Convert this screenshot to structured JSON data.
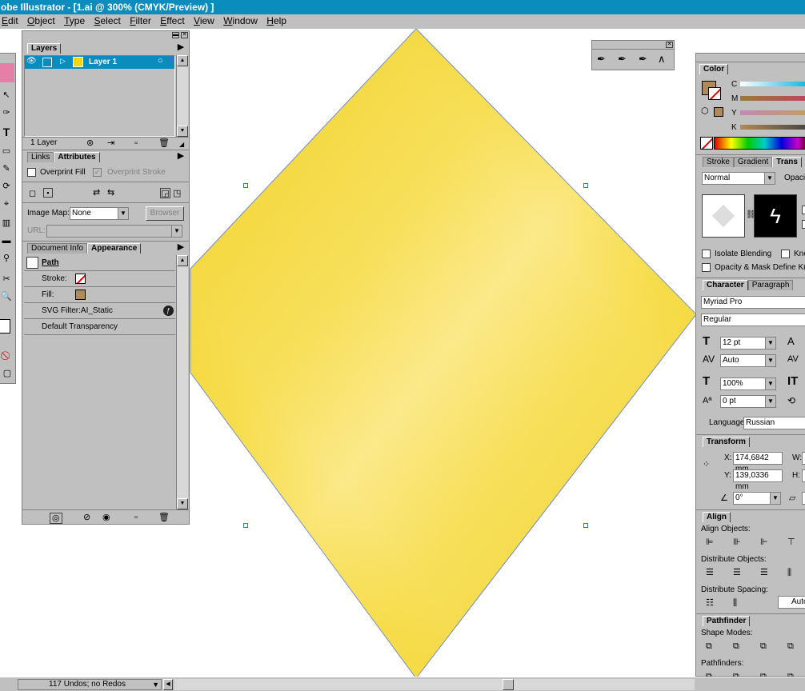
{
  "app": {
    "title": "obe Illustrator - [1.ai @ 300% (CMYK/Preview) ]"
  },
  "menu": [
    "Edit",
    "Object",
    "Type",
    "Select",
    "Filter",
    "Effect",
    "View",
    "Window",
    "Help"
  ],
  "colors": {
    "accent": "#0a8cbc",
    "diamond": "#f5d418",
    "fill_swatch": "#b08a5a"
  },
  "layers_panel": {
    "tab": "Layers",
    "layer_name": "Layer 1",
    "footer_count": "1 Layer"
  },
  "links_attr_panel": {
    "tabs": [
      "Links",
      "Attributes"
    ],
    "overprint_fill": "Overprint Fill",
    "overprint_stroke": "Overprint Stroke",
    "image_map_label": "Image Map:",
    "image_map_value": "None",
    "browser_button": "Browser",
    "url_label": "URL:"
  },
  "appearance_panel": {
    "tabs": [
      "Document Info",
      "Appearance"
    ],
    "object_name": "Path",
    "stroke_label": "Stroke:",
    "fill_label": "Fill:",
    "svg_filter": "SVG Filter:AI_Static",
    "default_transparency": "Default Transparency"
  },
  "pen_palette": {
    "icons": [
      "pen-icon",
      "add-anchor-icon",
      "delete-anchor-icon",
      "convert-anchor-icon"
    ]
  },
  "color_panel": {
    "tab": "Color",
    "channels": [
      "C",
      "M",
      "Y",
      "K"
    ]
  },
  "transparency_panel": {
    "tabs": [
      "Stroke",
      "Gradient",
      "Trans"
    ],
    "blend_mode": "Normal",
    "opacity_label": "Opaci",
    "isolate_blending": "Isolate Blending",
    "knockout": "Kno",
    "opacity_mask": "Opacity & Mask Define Kno"
  },
  "character_panel": {
    "tabs": [
      "Character",
      "Paragraph"
    ],
    "font": "Myriad Pro",
    "style": "Regular",
    "size": "12 pt",
    "tracking": "Auto",
    "scale": "100%",
    "baseline": "0 pt",
    "language_label": "Language:",
    "language": "Russian"
  },
  "transform_panel": {
    "tab": "Transform",
    "x_label": "X:",
    "x_value": "174,6842 mm",
    "y_label": "Y:",
    "y_value": "139,0336 mm",
    "w_label": "W:",
    "h_label": "H:",
    "angle": "0°"
  },
  "align_panel": {
    "tab": "Align",
    "align_objects": "Align Objects:",
    "distribute_objects": "Distribute Objects:",
    "distribute_spacing": "Distribute Spacing:",
    "auto": "Auto"
  },
  "pathfinder_panel": {
    "tab": "Pathfinder",
    "shape_modes": "Shape Modes:",
    "pathfinders": "Pathfinders:"
  },
  "statusbar": {
    "undo": "117 Undos; no Redos"
  }
}
